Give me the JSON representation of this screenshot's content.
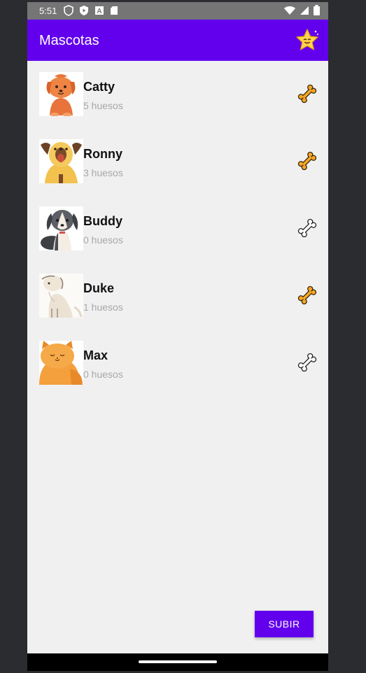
{
  "status_bar": {
    "time": "5:51",
    "left_icons": [
      "shield-icon",
      "play-protect-icon",
      "a-icon",
      "sd-card-icon"
    ],
    "right_icons": [
      "wifi-icon",
      "signal-icon",
      "battery-icon"
    ]
  },
  "app_bar": {
    "title": "Mascotas",
    "action_icon": "star-icon",
    "color": "#6200ee"
  },
  "pets": [
    {
      "name": "Catty",
      "bones": "5 huesos",
      "has_bone": true,
      "animal": "orange-puppy"
    },
    {
      "name": "Ronny",
      "bones": "3 huesos",
      "has_bone": true,
      "animal": "yellow-dog"
    },
    {
      "name": "Buddy",
      "bones": "0 huesos",
      "has_bone": false,
      "animal": "gray-dog"
    },
    {
      "name": "Duke",
      "bones": "1 huesos",
      "has_bone": true,
      "animal": "cream-dog"
    },
    {
      "name": "Max",
      "bones": "0 huesos",
      "has_bone": false,
      "animal": "orange-cat"
    }
  ],
  "upload_button": "SUBIR",
  "colors": {
    "accent": "#6200ee",
    "bone_filled": "#f5a623",
    "secondary_text": "#a8a8a8"
  }
}
